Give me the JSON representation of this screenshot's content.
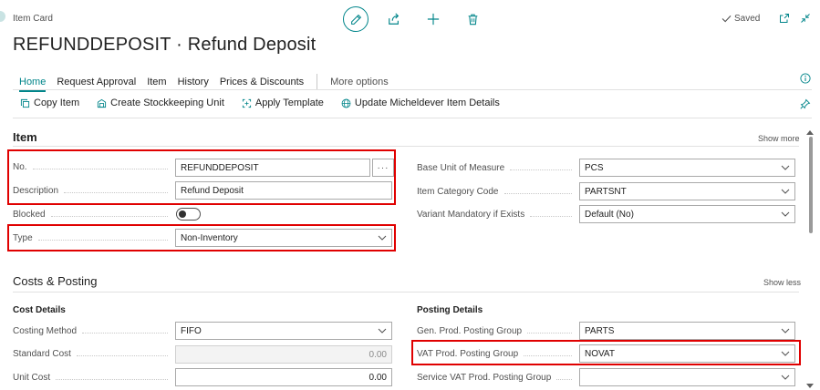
{
  "header": {
    "caption": "Item Card",
    "title": "REFUNDDEPOSIT · Refund Deposit",
    "saved_label": "Saved"
  },
  "nav": {
    "tabs": [
      "Home",
      "Request Approval",
      "Item",
      "History",
      "Prices & Discounts"
    ],
    "more_label": "More options"
  },
  "actions": {
    "copy_item": "Copy Item",
    "create_sku": "Create Stockkeeping Unit",
    "apply_template": "Apply Template",
    "update_item": "Update Micheldever Item Details"
  },
  "item_section": {
    "title": "Item",
    "show_link": "Show more",
    "left": {
      "no_label": "No.",
      "no_value": "REFUNDDEPOSIT",
      "no_assist": "···",
      "description_label": "Description",
      "description_value": "Refund Deposit",
      "blocked_label": "Blocked",
      "type_label": "Type",
      "type_value": "Non-Inventory"
    },
    "right": {
      "base_uom_label": "Base Unit of Measure",
      "base_uom_value": "PCS",
      "category_label": "Item Category Code",
      "category_value": "PARTSNT",
      "variant_label": "Variant Mandatory if Exists",
      "variant_value": "Default (No)"
    }
  },
  "costs_section": {
    "title": "Costs & Posting",
    "show_link": "Show less",
    "cost_details": {
      "heading": "Cost Details",
      "costing_method_label": "Costing Method",
      "costing_method_value": "FIFO",
      "standard_cost_label": "Standard Cost",
      "standard_cost_value": "0.00",
      "unit_cost_label": "Unit Cost",
      "unit_cost_value": "0.00"
    },
    "posting_details": {
      "heading": "Posting Details",
      "gen_prod_label": "Gen. Prod. Posting Group",
      "gen_prod_value": "PARTS",
      "vat_prod_label": "VAT Prod. Posting Group",
      "vat_prod_value": "NOVAT",
      "service_vat_label": "Service VAT Prod. Posting Group",
      "service_vat_value": ""
    }
  },
  "colors": {
    "accent": "#00858a",
    "highlight": "#e00000"
  }
}
